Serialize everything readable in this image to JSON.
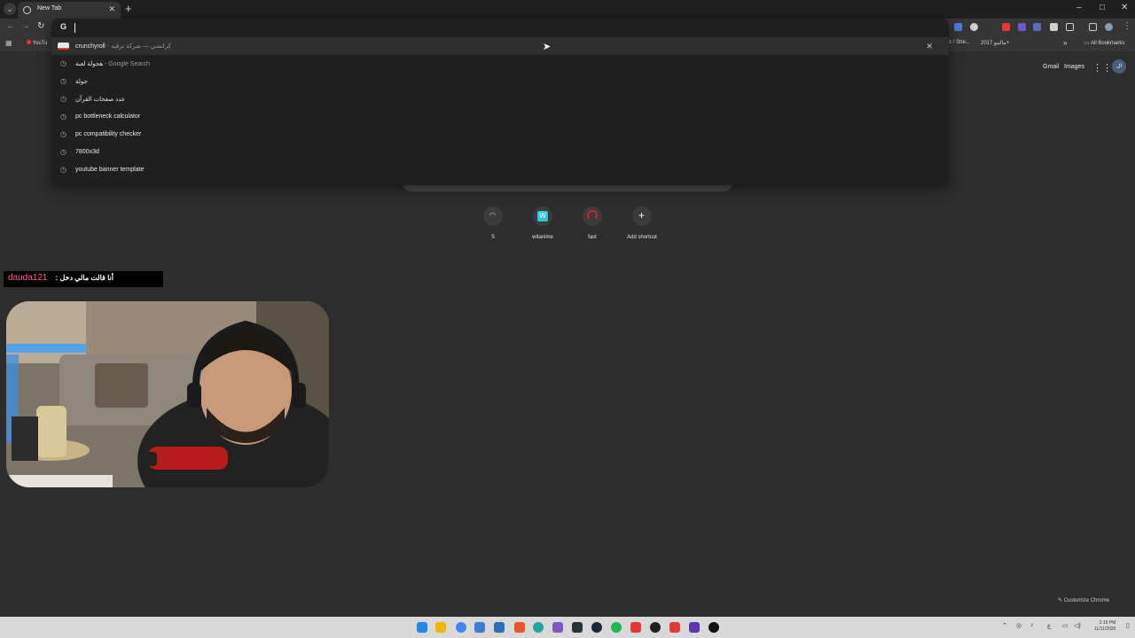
{
  "browser": {
    "tab": {
      "title": "New Tab"
    },
    "new_tab_symbol": "+",
    "window_controls": [
      "–",
      "□",
      "✕"
    ],
    "bookmarks": {
      "youtube": "YouTu",
      "items": [
        "x / Stre...",
        "مالتيو 2017+",
        "All Bookmarks"
      ]
    }
  },
  "omnibox": {
    "g_icon": "G",
    "suggestions": [
      {
        "text": "crunchyroll",
        "sub": "- كرانشي — شركة ترفيه",
        "icon": "crunchyroll-favicon"
      },
      {
        "text": "هجولة لعبة",
        "sub": " - Google Search",
        "icon": "history-icon"
      },
      {
        "text": "جولة",
        "sub": "",
        "icon": "history-icon"
      },
      {
        "text": "عدد صفحات القرآن",
        "sub": "",
        "icon": "history-icon"
      },
      {
        "text": "pc bottleneck calculator",
        "sub": "",
        "icon": "history-icon"
      },
      {
        "text": "pc compatibility checker",
        "sub": "",
        "icon": "history-icon"
      },
      {
        "text": "7800x3d",
        "sub": "",
        "icon": "history-icon"
      },
      {
        "text": "youtube banner template",
        "sub": "",
        "icon": "history-icon"
      }
    ],
    "remove_symbol": "✕"
  },
  "ntp": {
    "links": {
      "gmail": "Gmail",
      "images": "Images"
    },
    "avatar_initials": "ال",
    "shortcuts": [
      {
        "label": "S",
        "color": "#3c3c3c"
      },
      {
        "label": "witanime",
        "color": "#2ec5d3"
      },
      {
        "label": "fast",
        "color": "#c62828"
      },
      {
        "label": "Add shortcut",
        "color": "#3c3c3c"
      }
    ],
    "customize": "Customize Chrome"
  },
  "stream": {
    "chat_user": "dauda121",
    "chat_message": ": أنا قالت مالي دخل"
  },
  "taskbar": {
    "clock_time": "2:19 PM",
    "clock_date": "11/11/2025",
    "lang": "ع"
  },
  "colors": {
    "accent_red": "#e53935",
    "chat_user": "#ff5c93"
  }
}
